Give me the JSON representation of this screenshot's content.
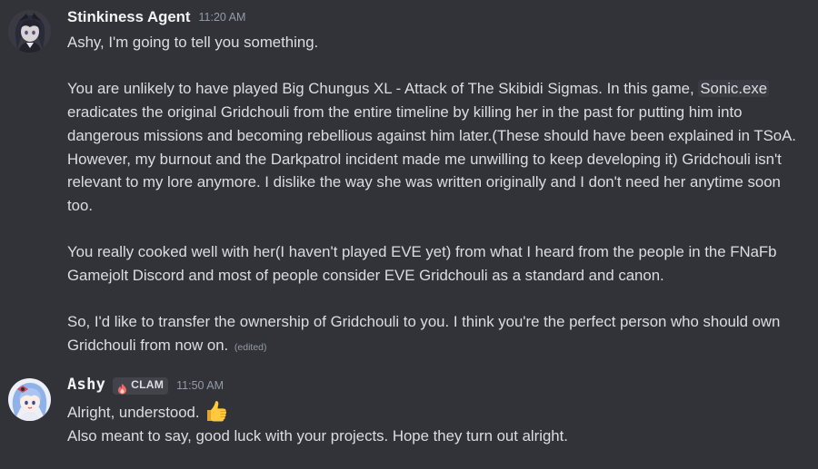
{
  "messages": [
    {
      "author": "Stinkiness Agent",
      "timestamp": "11:20 AM",
      "avatar_icon": "avatar-dark-hair-character",
      "lines": [
        "Ashy, I'm going to tell you something.",
        "",
        "You are unlikely to have played Big Chungus XL - Attack of The Skibidi Sigmas. In this game, ",
        "eradicates the original Gridchouli from the entire timeline by killing her in the past for putting him into dangerous missions and becoming rebellious against him later.(These should have been explained in TSoA. However, my burnout and the Darkpatrol incident made me unwilling to keep developing it) Gridchouli isn't relevant to my lore anymore. I dislike the way she was written originally and I don't need her anytime soon too.",
        "",
        "You really cooked well with her(I haven't played EVE yet) from what I heard from the people in the FNaFb Gamejolt Discord and most of people consider EVE Gridchouli as a standard and canon.",
        "",
        "So, I'd like to transfer the ownership of Gridchouli to you. I think you're the perfect person who should own Gridchouli from now on."
      ],
      "code_span": "Sonic.exe",
      "edited_label": "(edited)"
    },
    {
      "author": "Ashy",
      "timestamp": "11:50 AM",
      "clan_tag": "CLAM",
      "clan_icon": "flame-badge-icon",
      "avatar_icon": "avatar-blue-hair-character",
      "lines": [
        "Alright, understood.",
        "Also meant to say, good luck with your projects. Hope they turn out alright."
      ],
      "emoji": "thumbs-up-emoji"
    }
  ],
  "colors": {
    "background": "#323339",
    "text": "#dbdee1",
    "username": "#f2f3f5",
    "timestamp": "#949ba4",
    "tag_bg": "#43444b",
    "code_bg": "#3b3c43"
  }
}
